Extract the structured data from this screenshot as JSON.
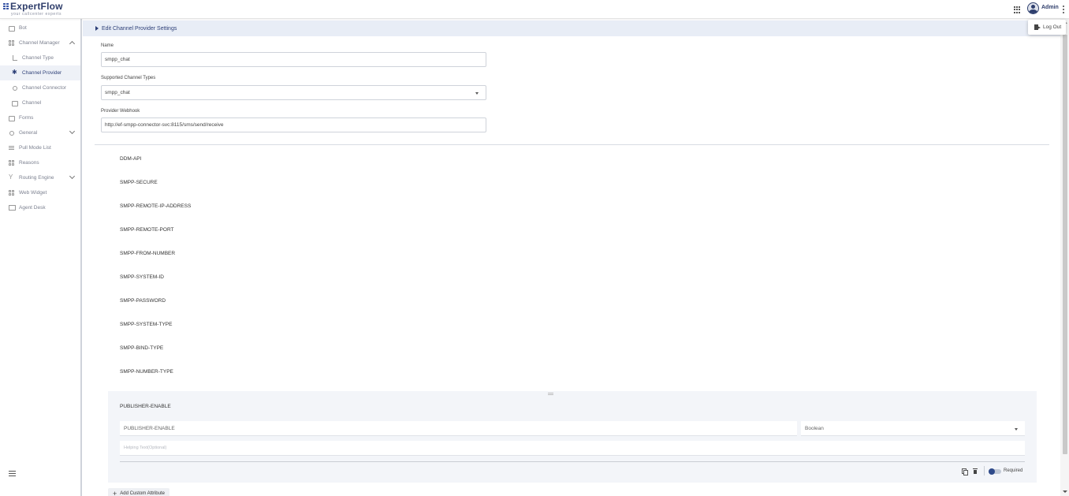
{
  "header": {
    "logo_main": "ExpertFlow",
    "logo_tagline": "your callcenter experts",
    "user_name": "Admin",
    "logout_label": "Log Out"
  },
  "sidebar": {
    "items": [
      {
        "label": "Bot",
        "icon": "bot-icon"
      },
      {
        "label": "Channel Manager",
        "icon": "channel-manager-icon",
        "expanded": true
      },
      {
        "label": "Channel Type",
        "icon": "channel-type-icon"
      },
      {
        "label": "Channel Provider",
        "icon": "channel-provider-icon",
        "active": true
      },
      {
        "label": "Channel Connector",
        "icon": "channel-connector-icon"
      },
      {
        "label": "Channel",
        "icon": "channel-icon"
      },
      {
        "label": "Forms",
        "icon": "forms-icon"
      },
      {
        "label": "General",
        "icon": "general-icon",
        "expanded": false
      },
      {
        "label": "Pull Mode List",
        "icon": "list-icon"
      },
      {
        "label": "Reasons",
        "icon": "reasons-icon"
      },
      {
        "label": "Routing Engine",
        "icon": "routing-icon",
        "expanded": false
      },
      {
        "label": "Web Widget",
        "icon": "widget-icon"
      },
      {
        "label": "Agent Desk",
        "icon": "agent-desk-icon"
      }
    ]
  },
  "main": {
    "section_title": "Edit Channel Provider Settings",
    "name_label": "Name",
    "name_value": "smpp_chat",
    "channel_types_label": "Supported Channel Types",
    "channel_types_value": "smpp_chat",
    "webhook_label": "Provider Webhook",
    "webhook_value": "http://ef-smpp-connector-svc:8115/sms/send/receive",
    "attributes": [
      "DDM-API",
      "SMPP-SECURE",
      "SMPP-REMOTE-IP-ADDRESS",
      "SMPP-REMOTE-PORT",
      "SMPP-FROM-NUMBER",
      "SMPP-SYSTEM-ID",
      "SMPP-PASSWORD",
      "SMPP-SYSTEM-TYPE",
      "SMPP-BIND-TYPE",
      "SMPP-NUMBER-TYPE"
    ],
    "expanded_attribute": {
      "title": "PUBLISHER-ENABLE",
      "key_value": "PUBLISHER-ENABLE",
      "type_value": "Boolean",
      "helping_text_placeholder": "Helping Text(Optional)",
      "required_label": "Required",
      "required": true
    },
    "add_custom_attribute_label": "Add Custom Attribute"
  },
  "colors": {
    "accent": "#2d3f77",
    "header_band": "#e8edf6",
    "panel_bg": "#f3f5f9"
  }
}
